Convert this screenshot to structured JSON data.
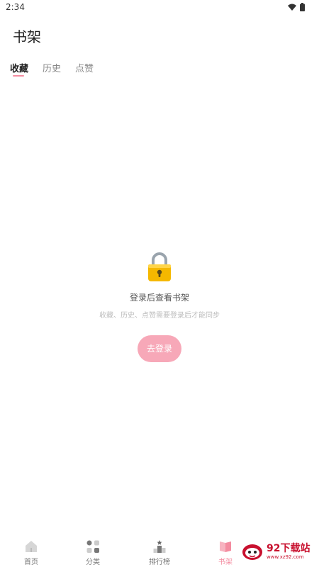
{
  "status_bar": {
    "time": "2:34"
  },
  "header": {
    "title": "书架"
  },
  "tabs": [
    {
      "label": "收藏",
      "active": true
    },
    {
      "label": "历史",
      "active": false
    },
    {
      "label": "点赞",
      "active": false
    }
  ],
  "empty_state": {
    "icon": "lock-icon",
    "title": "登录后查看书架",
    "subtitle": "收藏、历史、点赞需要登录后才能同步",
    "button_label": "去登录"
  },
  "bottom_nav": [
    {
      "label": "首页",
      "icon": "home-icon",
      "active": false
    },
    {
      "label": "分类",
      "icon": "category-icon",
      "active": false
    },
    {
      "label": "排行榜",
      "icon": "ranking-icon",
      "active": false
    },
    {
      "label": "书架",
      "icon": "bookshelf-icon",
      "active": true
    }
  ],
  "watermark": {
    "text": "92下载站",
    "url": "www.xz92.com"
  },
  "colors": {
    "accent": "#f48ca0",
    "button": "#f7a8b8"
  }
}
